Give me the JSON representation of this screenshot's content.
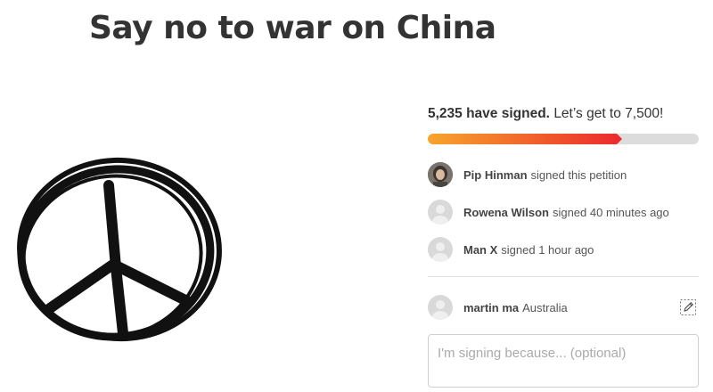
{
  "petition": {
    "title": "Say no to war on China"
  },
  "progress": {
    "signed_count": "5,235 have signed.",
    "goal_text": "Let’s get to 7,500!",
    "signed": 5235,
    "goal": 7500,
    "bar_colors": [
      "#f7a42c",
      "#ec2c2c"
    ]
  },
  "recent_signers": [
    {
      "name": "Pip Hinman",
      "action": "signed this petition",
      "avatar": "photo"
    },
    {
      "name": "Rowena Wilson",
      "action": "signed 40 minutes ago",
      "avatar": "default"
    },
    {
      "name": "Man X",
      "action": "signed 1 hour ago",
      "avatar": "default"
    }
  ],
  "current_user": {
    "name": "martin ma",
    "location": "Australia",
    "edit_icon": "pencil-icon"
  },
  "reason_field": {
    "placeholder": "I'm signing because... (optional)",
    "value": ""
  },
  "image": {
    "icon": "peace-symbol"
  }
}
